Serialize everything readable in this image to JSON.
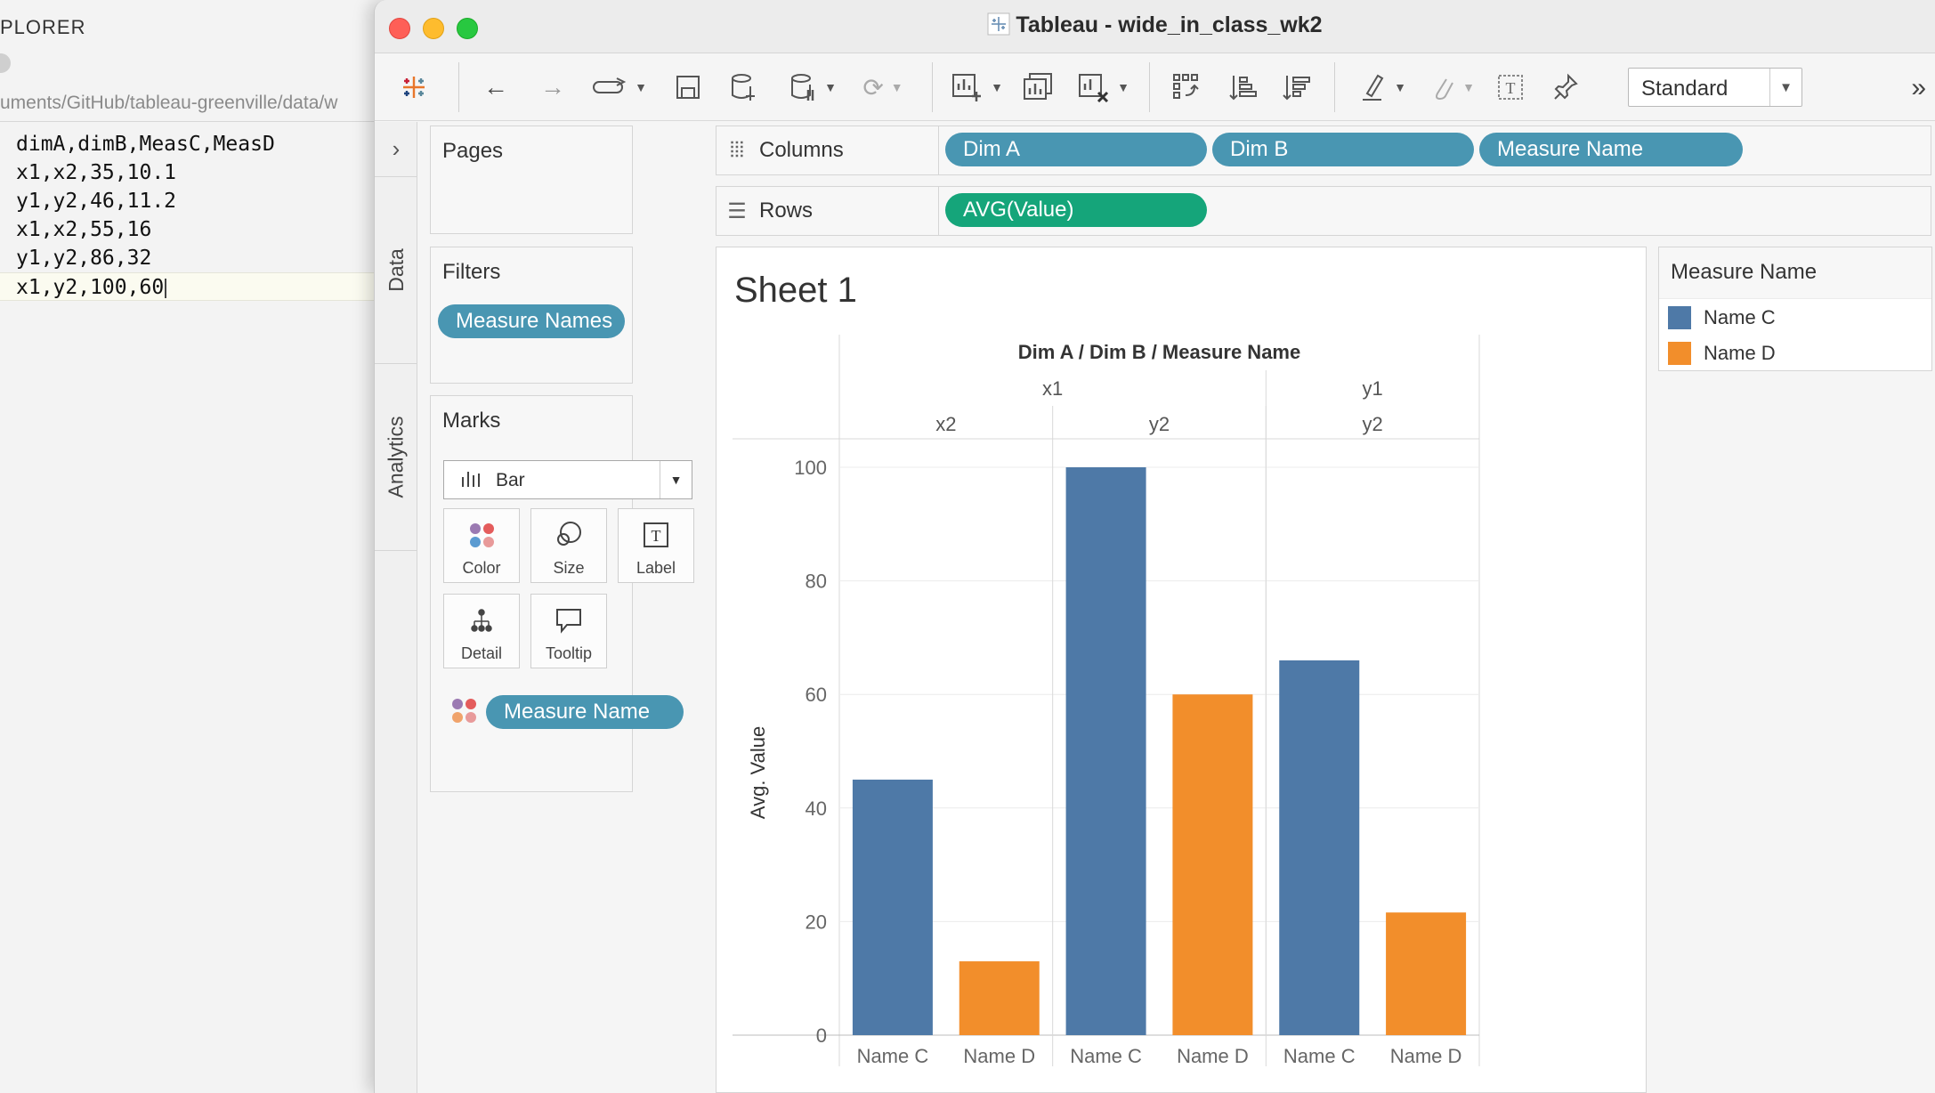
{
  "editor": {
    "title": "PLORER",
    "path": "uments/GitHub/tableau-greenville/data/w",
    "lines": [
      "dimA,dimB,MeasC,MeasD",
      "x1,x2,35,10.1",
      "y1,y2,46,11.2",
      "x1,x2,55,16",
      "y1,y2,86,32",
      "x1,y2,100,60"
    ]
  },
  "window": {
    "title": "Tableau - wide_in_class_wk2"
  },
  "toolbar": {
    "icons": [
      "tableau-logo-icon",
      "back-icon",
      "forward-icon",
      "redo-icon",
      "save-icon",
      "new-datasource-icon",
      "pause-datasource-icon",
      "refresh-icon",
      "new-worksheet-icon",
      "duplicate-sheet-icon",
      "clear-sheet-icon",
      "swap-icon",
      "sort-ascending-icon",
      "sort-descending-icon",
      "highlight-icon",
      "group-icon",
      "label-icon",
      "pin-icon"
    ],
    "fit_select": "Standard",
    "more": "»"
  },
  "side_tabs": {
    "expand": "›",
    "data": "Data",
    "analytics": "Analytics"
  },
  "pages": {
    "title": "Pages"
  },
  "filters": {
    "title": "Filters",
    "pill": "Measure Names"
  },
  "marks": {
    "title": "Marks",
    "type": "Bar",
    "buttons": {
      "color": "Color",
      "size": "Size",
      "label": "Label",
      "detail": "Detail",
      "tooltip": "Tooltip"
    },
    "color_pill": "Measure Name"
  },
  "columns": {
    "label": "Columns",
    "pills": [
      "Dim A",
      "Dim B",
      "Measure Name"
    ]
  },
  "rows": {
    "label": "Rows",
    "pills": [
      "AVG(Value)"
    ]
  },
  "sheet": {
    "title": "Sheet 1"
  },
  "legend": {
    "title": "Measure Name",
    "items": [
      {
        "label": "Name C",
        "color": "#4e79a7"
      },
      {
        "label": "Name D",
        "color": "#f28e2b"
      }
    ]
  },
  "colors": {
    "pill_blue": "#4996b2",
    "pill_green": "#15a57a",
    "series_c": "#4e79a7",
    "series_d": "#f28e2b"
  },
  "chart_data": {
    "type": "bar",
    "header": "Dim A / Dim B / Measure Name",
    "ylabel": "Avg. Value",
    "ylim": [
      0,
      100
    ],
    "yticks": [
      0,
      20,
      40,
      60,
      80,
      100
    ],
    "dim_a": [
      {
        "label": "x1",
        "span": 2
      },
      {
        "label": "y1",
        "span": 1
      }
    ],
    "groups": [
      {
        "dim_a": "x1",
        "dim_b": "x2",
        "bars": [
          {
            "label": "Name C",
            "value": 45
          },
          {
            "label": "Name D",
            "value": 13
          }
        ]
      },
      {
        "dim_a": "x1",
        "dim_b": "y2",
        "bars": [
          {
            "label": "Name C",
            "value": 100
          },
          {
            "label": "Name D",
            "value": 60
          }
        ]
      },
      {
        "dim_a": "y1",
        "dim_b": "y2",
        "bars": [
          {
            "label": "Name C",
            "value": 66
          },
          {
            "label": "Name D",
            "value": 21.6
          }
        ]
      }
    ]
  }
}
